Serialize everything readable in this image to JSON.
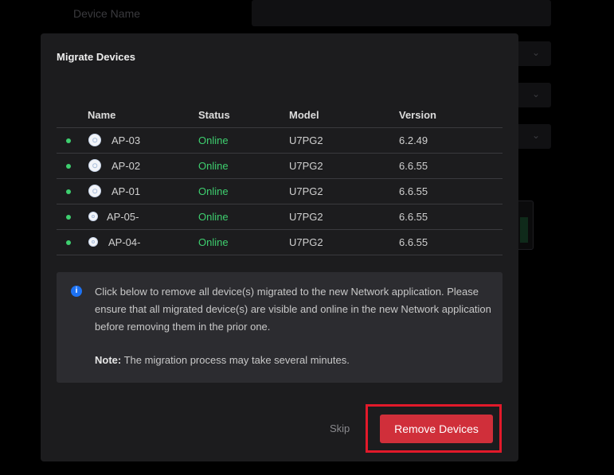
{
  "background": {
    "field_label": "Device Name"
  },
  "modal": {
    "title": "Migrate Devices",
    "columns": {
      "name": "Name",
      "status": "Status",
      "model": "Model",
      "version": "Version"
    },
    "devices": [
      {
        "name": "AP-03",
        "status": "Online",
        "model": "U7PG2",
        "version": "6.2.49"
      },
      {
        "name": "AP-02",
        "status": "Online",
        "model": "U7PG2",
        "version": "6.6.55"
      },
      {
        "name": "AP-01",
        "status": "Online",
        "model": "U7PG2",
        "version": "6.6.55"
      },
      {
        "name": "AP-05-",
        "status": "Online",
        "model": "U7PG2",
        "version": "6.6.55"
      },
      {
        "name": "AP-04-",
        "status": "Online",
        "model": "U7PG2",
        "version": "6.6.55"
      }
    ],
    "info": {
      "message": "Click below to remove all device(s) migrated to the new Network application. Please ensure that all migrated device(s) are visible and online in the new Network application before removing them in the prior one.",
      "note_label": "Note:",
      "note_text": "The migration process may take several minutes."
    },
    "actions": {
      "skip_label": "Skip",
      "remove_label": "Remove Devices"
    }
  },
  "colors": {
    "online": "#3ecf6f",
    "danger": "#d02f3a",
    "info": "#1d72f3",
    "highlight": "#e2192a"
  }
}
